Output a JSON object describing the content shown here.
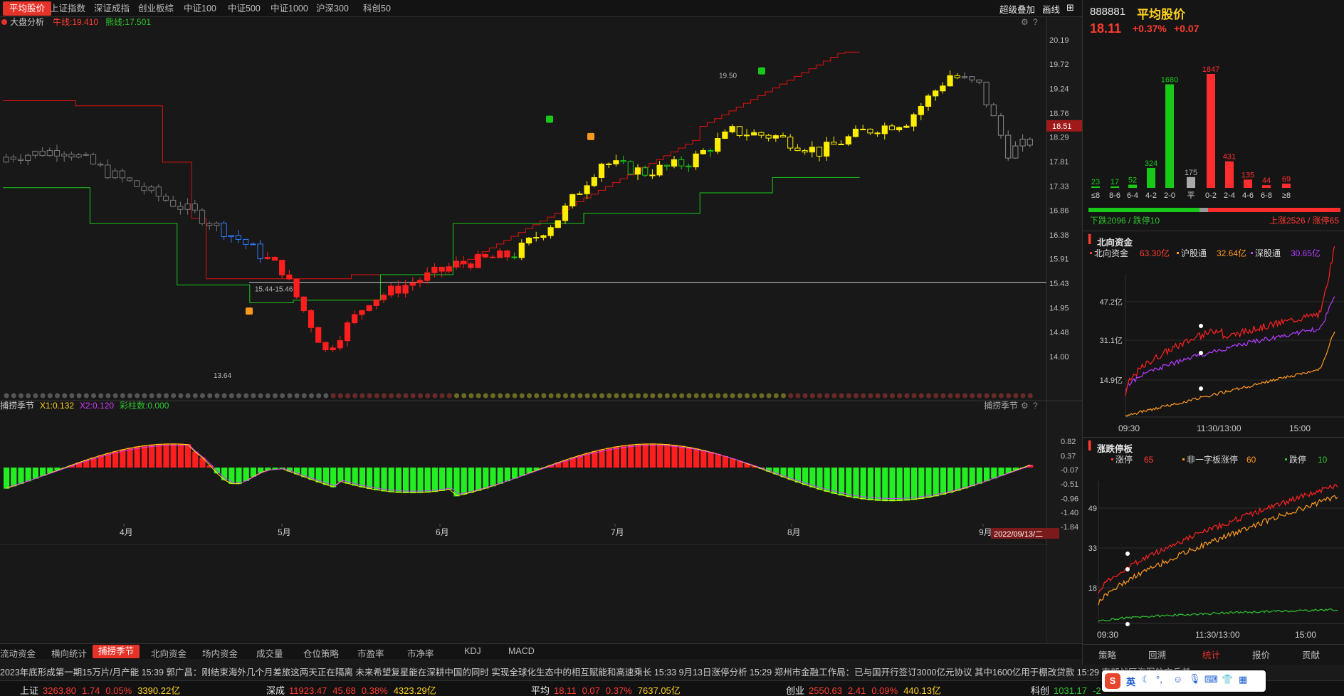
{
  "topnav": {
    "tabs": [
      "平均股价",
      "上证指数",
      "深证成指",
      "创业板综",
      "中证100",
      "中证500",
      "中证1000",
      "沪深300",
      "科创50"
    ],
    "active": 0,
    "overlay_btn": "超级叠加",
    "draw_btn": "画线"
  },
  "chart": {
    "indicator_name": "大盘分析",
    "bull_label": "牛线:19.410",
    "bear_label": "熊线:17.501",
    "price_axis": [
      "20.19",
      "19.72",
      "19.24",
      "18.76",
      "18.29",
      "17.81",
      "17.33",
      "16.86",
      "16.38",
      "15.91",
      "15.43",
      "14.95",
      "14.48",
      "14.00"
    ],
    "current_price_tag": "18.51",
    "high_label": "19.50",
    "low_label": "13.64",
    "range_label": "15.44-15.46",
    "sub_name": "捕捞季节",
    "sub_x1": "X1:0.132",
    "sub_x2": "X2:0.120",
    "sub_bars": "彩柱数:0.000",
    "sub_right_label": "捕捞季节",
    "sub_axis": [
      "0.82",
      "0.37",
      "-0.07",
      "-0.51",
      "-0.96",
      "-1.40",
      "-1.84"
    ],
    "months": [
      "4月",
      "5月",
      "6月",
      "7月",
      "8月",
      "9月"
    ],
    "date_tag": "2022/09/13/二",
    "colors": {
      "up": "#ff1e1e",
      "down": "#1a1a1a",
      "yellow": "#ffee00",
      "bull": "#e01010",
      "bear": "#19c919",
      "blue": "#2e7bff"
    }
  },
  "chart_data": {
    "type": "candlestick",
    "title": "平均股价",
    "ylim": [
      13.64,
      20.19
    ],
    "high": 19.5,
    "low": 13.64,
    "last": 18.51,
    "x_months": [
      "4月",
      "5月",
      "6月",
      "7月",
      "8月",
      "9月"
    ]
  },
  "bottomtabs": {
    "tabs": [
      "流动资金",
      "横向统计",
      "捕捞季节",
      "北向资金",
      "场内资金",
      "成交量",
      "仓位策略",
      "市盈率",
      "市净率",
      "KDJ",
      "MACD"
    ],
    "active": 2
  },
  "right": {
    "code": "888881",
    "name": "平均股价",
    "price": "18.11",
    "pct": "+0.37%",
    "chg": "+0.07",
    "dist": {
      "labels": [
        "≤8",
        "8-6",
        "6-4",
        "4-2",
        "2-0",
        "平",
        "0-2",
        "2-4",
        "4-6",
        "6-8",
        "≥8"
      ],
      "values": [
        23,
        17,
        52,
        324,
        1680,
        175,
        1847,
        431,
        135,
        44,
        69
      ],
      "value_labels": [
        "23",
        "17",
        "52",
        "324",
        "1680",
        "175",
        "1847",
        "431",
        "135",
        "44",
        "69"
      ]
    },
    "down_text": "下跌2096 / 跌停10",
    "up_text": "上涨2526 / 涨停65",
    "north_title": "北向资金",
    "north_legend": [
      {
        "name": "北向资金",
        "val": "63.30亿"
      },
      {
        "name": "沪股通",
        "val": "32.64亿"
      },
      {
        "name": "深股通",
        "val": "30.65亿"
      }
    ],
    "north_axis": [
      "47.2亿",
      "31.1亿",
      "14.9亿"
    ],
    "north_times": [
      "09:30",
      "11:30/13:00",
      "15:00"
    ],
    "limit_title": "涨跌停板",
    "limit_legend": [
      {
        "name": "涨停",
        "val": "65"
      },
      {
        "name": "非一字板涨停",
        "val": "60"
      },
      {
        "name": "跌停",
        "val": "10"
      }
    ],
    "limit_axis": [
      "49",
      "33",
      "18"
    ],
    "limit_times": [
      "09:30",
      "11:30/13:00",
      "15:00"
    ],
    "tabs": [
      "策略",
      "回溯",
      "统计",
      "报价",
      "贡献"
    ],
    "active_tab": 2
  },
  "news": "2023年底形成第一期15万片/月产能    15:39 郭广昌：刚结束海外几个月差旅这两天正在隔离 未来希望复星能在深耕中国的同时 实现全球化生态中的相互赋能和高速乘长    15:33 9月13日涨停分析    15:29 郑州市金融工作局：已与国开行签订3000亿元协议 其中1600亿用于棚改贷款    15:29 南部战区海军航空兵某",
  "status": [
    {
      "name": "上证",
      "price": "3263.80",
      "chg": "1.74",
      "pct": "0.05%",
      "amt": "3390.22亿"
    },
    {
      "name": "深成",
      "price": "11923.47",
      "chg": "45.68",
      "pct": "0.38%",
      "amt": "4323.29亿"
    },
    {
      "name": "平均",
      "price": "18.11",
      "chg": "0.07",
      "pct": "0.37%",
      "amt": "7637.05亿"
    },
    {
      "name": "创业",
      "price": "2550.63",
      "chg": "2.41",
      "pct": "0.09%",
      "amt": "440.13亿"
    },
    {
      "name": "科创",
      "price": "1031.17",
      "chg": "-2",
      "pct": "",
      "amt": ""
    }
  ],
  "ime": {
    "logo": "S",
    "lang": "英"
  }
}
